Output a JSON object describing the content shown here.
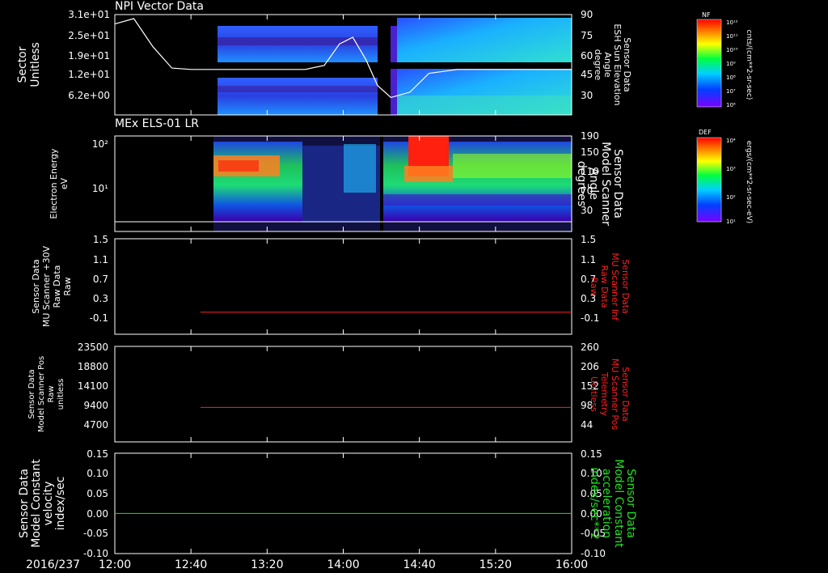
{
  "date_label": "2016/237",
  "time_ticks": [
    "12:00",
    "12:40",
    "13:20",
    "14:00",
    "14:40",
    "15:20",
    "16:00"
  ],
  "colors": {
    "red": "#ff2020",
    "green": "#20e020",
    "white": "#ffffff"
  },
  "panels": [
    {
      "title": "NPI Vector Data",
      "ylabel_left": [
        "Sector",
        "Unitless"
      ],
      "ylabel_right": [
        "Sensor Data",
        "ESH Sun Elevation",
        "Angle",
        "degree"
      ],
      "left_ticks": [
        "3.1e+01",
        "2.5e+01",
        "1.9e+01",
        "1.2e+01",
        "6.2e+00"
      ],
      "right_ticks": [
        "90",
        "75",
        "60",
        "45",
        "30"
      ],
      "colorbar": {
        "label": "NF",
        "units": "cnts/(cm**2-sr-sec)",
        "ticks": [
          "10¹²",
          "10¹¹",
          "10¹⁰",
          "10⁹",
          "10⁸",
          "10⁷",
          "10⁶"
        ]
      }
    },
    {
      "title": "MEx ELS-01 LR",
      "ylabel_left": [
        "Electron Energy",
        "eV"
      ],
      "ylabel_right": [
        "Sensor Data",
        "Model Scanner",
        "Angle",
        "degrees"
      ],
      "left_ticks": [
        "10²",
        "10¹"
      ],
      "right_ticks": [
        "190",
        "150",
        "110",
        "70",
        "30"
      ],
      "colorbar": {
        "label": "DEF",
        "units": "ergs/(cm**2-sr-sec-eV)",
        "ticks": [
          "10⁴",
          "10³",
          "10²",
          "10¹"
        ]
      }
    },
    {
      "ylabel_left": [
        "Sensor Data",
        "MU Scanner +30V",
        "Raw Data",
        "Raw"
      ],
      "ylabel_right": [
        "Sensor Data",
        "MU Scanner Inf",
        "Raw Data",
        "Raw"
      ],
      "left_ticks": [
        "1.5",
        "1.1",
        "0.7",
        "0.3",
        "-0.1"
      ],
      "right_ticks": [
        "1.5",
        "1.1",
        "0.7",
        "0.3",
        "-0.1"
      ]
    },
    {
      "ylabel_left": [
        "Sensor Data",
        "Model Scanner Pos",
        "Raw",
        "unitless"
      ],
      "ylabel_right": [
        "Sensor Data",
        "MU Scanner Pos",
        "Telemetry",
        "Unitless"
      ],
      "left_ticks": [
        "23500",
        "18800",
        "14100",
        "9400",
        "4700"
      ],
      "right_ticks": [
        "260",
        "206",
        "152",
        "98",
        "44"
      ]
    },
    {
      "ylabel_left": [
        "Sensor Data",
        "Model Constant",
        "velocity",
        "index/sec"
      ],
      "ylabel_right": [
        "Sensor Data",
        "Model Constant",
        "acceleration",
        "index/sec**2"
      ],
      "left_ticks": [
        "0.15",
        "0.10",
        "0.05",
        "0.00",
        "-0.05",
        "-0.10"
      ],
      "right_ticks": [
        "0.15",
        "0.10",
        "0.05",
        "0.00",
        "-0.05",
        "-0.10"
      ]
    }
  ],
  "chart_data": [
    {
      "type": "line",
      "name": "ESH Sun Elevation Angle",
      "x": [
        "12:00",
        "12:10",
        "12:20",
        "12:30",
        "12:40",
        "13:00",
        "13:40",
        "13:50",
        "13:58",
        "14:05",
        "14:12",
        "14:18",
        "14:25",
        "14:35",
        "14:45",
        "15:00",
        "16:00"
      ],
      "y": [
        83,
        87,
        66,
        50,
        49,
        49,
        49,
        52,
        68,
        73,
        56,
        37,
        28,
        32,
        46,
        49,
        49
      ],
      "ylim": [
        15,
        90
      ]
    },
    {
      "type": "line",
      "name": "MU Scanner +30V Raw Data",
      "x": [
        "12:45",
        "16:00"
      ],
      "y": [
        0.0,
        0.0
      ],
      "ylim": [
        -0.45,
        1.5
      ]
    },
    {
      "type": "line",
      "name": "Model Scanner Pos Raw",
      "x": [
        "12:45",
        "16:00"
      ],
      "y": [
        8500,
        8500
      ],
      "ylim": [
        0,
        23500
      ]
    },
    {
      "type": "line",
      "name": "Model Constant velocity",
      "x": [
        "12:00",
        "16:00"
      ],
      "y": [
        0.0,
        0.0
      ],
      "ylim": [
        -0.1,
        0.15
      ]
    }
  ]
}
